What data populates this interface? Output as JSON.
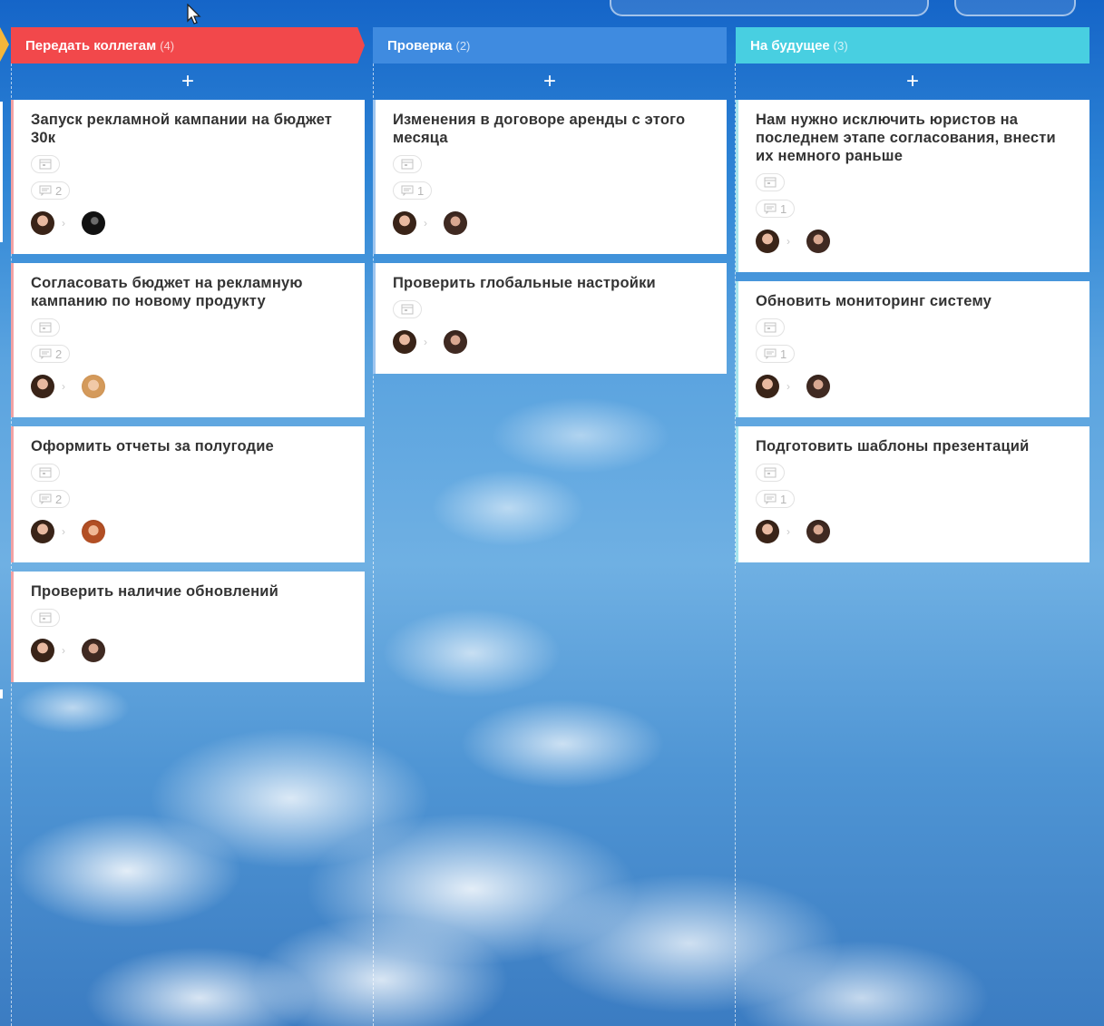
{
  "columns": [
    {
      "title": "Передать коллегам",
      "count": "(4)",
      "add_label": "+",
      "cards": [
        {
          "title": "Запуск рекламной кампании на бюджет 30к",
          "comments": "2"
        },
        {
          "title": "Согласовать бюджет на рекламную кампанию по новому продукту",
          "comments": "2"
        },
        {
          "title": "Оформить отчеты за полугодие",
          "comments": "2"
        },
        {
          "title": "Проверить наличие обновлений",
          "comments": ""
        }
      ]
    },
    {
      "title": "Проверка",
      "count": "(2)",
      "add_label": "+",
      "cards": [
        {
          "title": "Изменения в договоре аренды с этого месяца",
          "comments": "1"
        },
        {
          "title": "Проверить глобальные настройки",
          "comments": ""
        }
      ]
    },
    {
      "title": "На будущее",
      "count": "(3)",
      "add_label": "+",
      "cards": [
        {
          "title": "Нам нужно исключить юристов на последнем этапе согласования, внести их немного раньше",
          "comments": "1"
        },
        {
          "title": "Обновить мониторинг систему",
          "comments": "1"
        },
        {
          "title": "Подготовить шаблоны презентаций",
          "comments": "1"
        }
      ]
    }
  ],
  "chevron": "›",
  "colors": {
    "col1": "#f2484b",
    "col2": "#3f8be0",
    "col3": "#48cfe1"
  }
}
